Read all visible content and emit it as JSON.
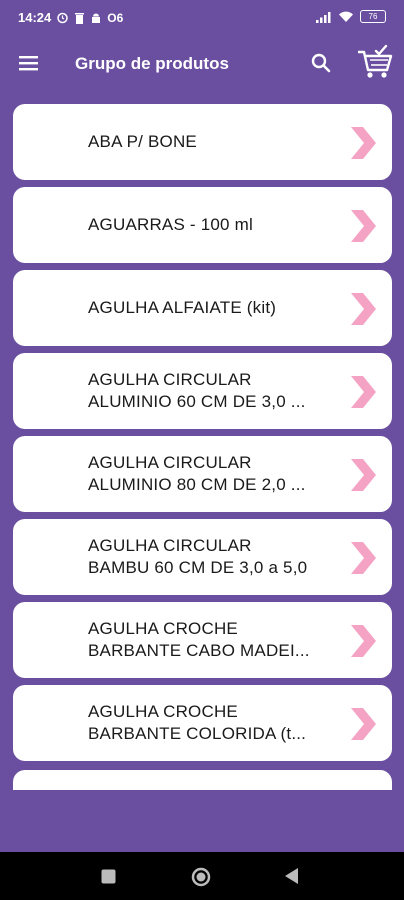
{
  "status_bar": {
    "time": "14:24",
    "network": "O6",
    "battery": "76"
  },
  "app_bar": {
    "title": "Grupo de produtos"
  },
  "products": [
    {
      "lines": [
        "ABA P/ BONE"
      ]
    },
    {
      "lines": [
        "AGUARRAS - 100 ml"
      ]
    },
    {
      "lines": [
        "AGULHA ALFAIATE (kit)"
      ]
    },
    {
      "lines": [
        "AGULHA CIRCULAR",
        "ALUMINIO 60 CM DE 3,0 ..."
      ]
    },
    {
      "lines": [
        "AGULHA CIRCULAR",
        "ALUMINIO 80 CM DE 2,0 ..."
      ]
    },
    {
      "lines": [
        "AGULHA CIRCULAR",
        "BAMBU 60 CM DE 3,0 a 5,0"
      ]
    },
    {
      "lines": [
        "AGULHA CROCHE",
        "BARBANTE CABO MADEI..."
      ]
    },
    {
      "lines": [
        "AGULHA CROCHE",
        "BARBANTE COLORIDA (t..."
      ]
    }
  ],
  "colors": {
    "background": "#6a4fa0",
    "chevron": "#f4a3c4",
    "card": "#ffffff"
  },
  "icons": {
    "menu": "menu-icon",
    "search": "search-icon",
    "cart": "cart-icon",
    "chevron": "chevron-right-icon"
  }
}
